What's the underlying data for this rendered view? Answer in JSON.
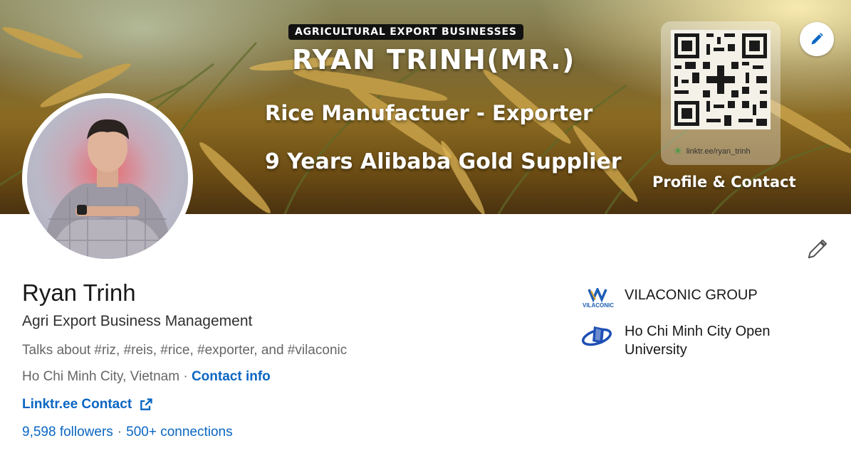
{
  "banner": {
    "tag": "AGRICULTURAL EXPORT BUSINESSES",
    "title": "RYAN TRINH(MR.)",
    "line1": "Rice Manufactuer - Exporter",
    "line2": "9 Years Alibaba Gold Supplier",
    "qr_link": "linktr.ee/ryan_trinh",
    "qr_caption": "Profile & Contact"
  },
  "profile": {
    "name": "Ryan Trinh",
    "headline": "Agri Export Business Management",
    "talks_about": "Talks about #riz, #reis, #rice, #exporter, and #vilaconic",
    "location": "Ho Chi Minh City, Vietnam",
    "location_sep": " · ",
    "contact_info": "Contact info",
    "website": "Linktr.ee Contact",
    "followers": "9,598 followers",
    "stats_sep": "·",
    "connections": "500+ connections"
  },
  "orgs": [
    {
      "name": "VILACONIC GROUP",
      "logo_text": "VILACONIC",
      "icon": "vilaconic-logo"
    },
    {
      "name": "Ho Chi Minh City Open University",
      "icon": "university-logo"
    }
  ],
  "icons": {
    "banner_edit": "pencil-icon",
    "intro_edit": "pencil-icon",
    "external_link": "external-link-icon"
  },
  "colors": {
    "link": "#0a66c2",
    "text_primary": "#191919",
    "text_secondary": "#666666"
  }
}
